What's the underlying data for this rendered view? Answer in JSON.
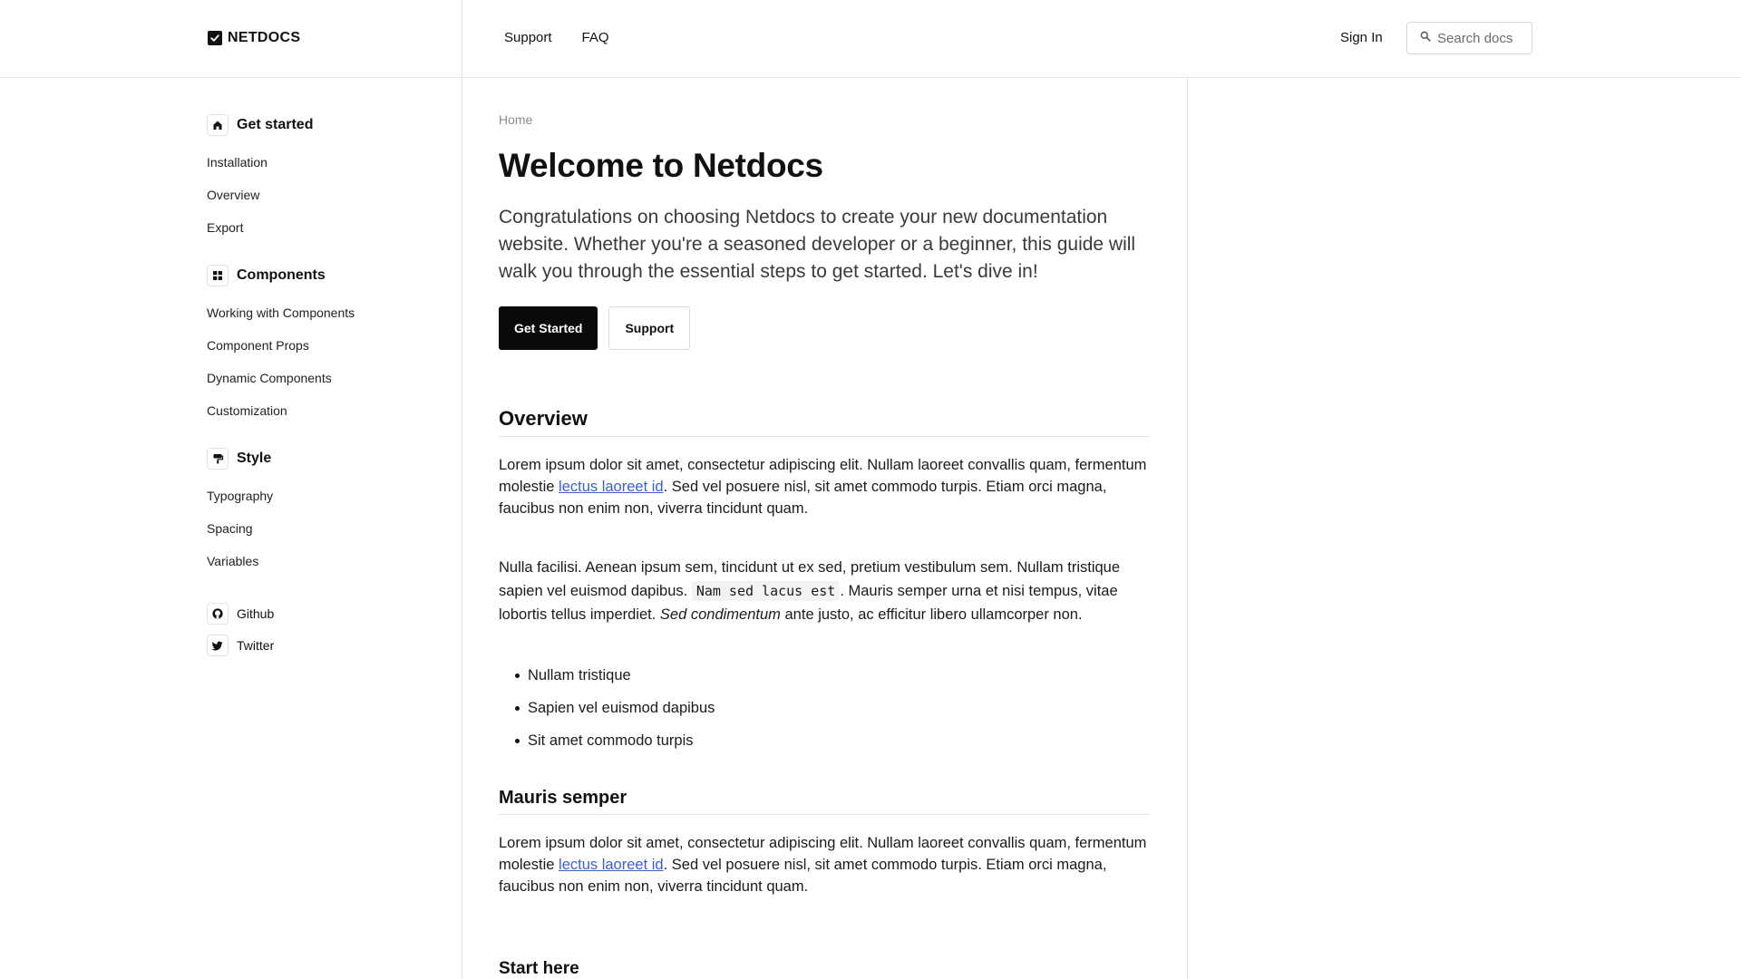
{
  "header": {
    "logo": "NETDOCS",
    "nav": [
      "Support",
      "FAQ"
    ],
    "signin": "Sign In",
    "search_placeholder": "Search docs"
  },
  "sidebar": {
    "sections": [
      {
        "title": "Get started",
        "icon": "home-icon",
        "items": [
          "Installation",
          "Overview",
          "Export"
        ]
      },
      {
        "title": "Components",
        "icon": "grid-icon",
        "items": [
          "Working with Components",
          "Component Props",
          "Dynamic Components",
          "Customization"
        ]
      },
      {
        "title": "Style",
        "icon": "paint-roller-icon",
        "items": [
          "Typography",
          "Spacing",
          "Variables"
        ]
      }
    ],
    "links": [
      {
        "label": "Github",
        "icon": "github-icon"
      },
      {
        "label": "Twitter",
        "icon": "twitter-icon"
      }
    ]
  },
  "main": {
    "breadcrumb": "Home",
    "title": "Welcome to Netdocs",
    "lead": "Congratulations on choosing Netdocs to create your new documentation website. Whether you're a seasoned developer or a beginner, this guide will walk you through the essential steps to get started. Let's dive in!",
    "primary_button": "Get Started",
    "secondary_button": "Support",
    "overview_heading": "Overview",
    "p1_a": "Lorem ipsum dolor sit amet, consectetur adipiscing elit. Nullam laoreet convallis quam, fermentum molestie ",
    "p1_link": "lectus laoreet id",
    "p1_b": ". Sed vel posuere nisl, sit amet commodo turpis. Etiam orci magna, faucibus non enim non, viverra tincidunt quam.",
    "p2_a": "Nulla facilisi. Aenean ipsum sem, tincidunt ut ex sed, pretium vestibulum sem. Nullam tristique sapien vel euismod dapibus. ",
    "p2_code": "Nam sed lacus est",
    "p2_b": ". Mauris semper urna et nisi tempus, vitae lobortis tellus imperdiet. ",
    "p2_em": "Sed condimentum",
    "p2_c": " ante justo, ac efficitur libero ullamcorper non.",
    "bullets": [
      "Nullam tristique",
      "Sapien vel euismod dapibus",
      "Sit amet commodo turpis"
    ],
    "mauris_heading": "Mauris semper",
    "p3_a": "Lorem ipsum dolor sit amet, consectetur adipiscing elit. Nullam laoreet convallis quam, fermentum molestie ",
    "p3_link": "lectus laoreet id",
    "p3_b": ". Sed vel posuere nisl, sit amet commodo turpis. Etiam orci magna, faucibus non enim non, viverra tincidunt quam.",
    "start_heading": "Start here"
  },
  "colors": {
    "link": "#3a63c4",
    "primary_button": "#0a0a0a",
    "border": "#e5e5e5"
  }
}
